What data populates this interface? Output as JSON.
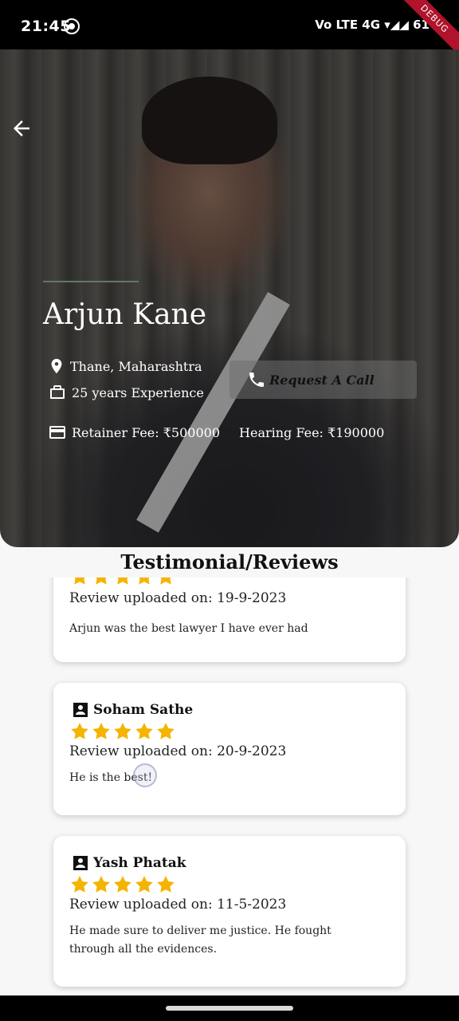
{
  "status_bar": {
    "time": "21:45",
    "right_icons": "Vo LTE 4G ▾◢◢ 61%",
    "debug_label": "DEBUG"
  },
  "profile": {
    "name": "Arjun Kane",
    "location": "Thane, Maharashtra",
    "experience": "25 years Experience",
    "retainer_fee": "Retainer Fee: ₹500000",
    "hearing_fee": "Hearing Fee: ₹190000",
    "call_button_label": "Request A Call"
  },
  "reviews_section": {
    "title": "Testimonial/Reviews",
    "reviews": [
      {
        "reviewer": "",
        "stars": 5,
        "date": "Review uploaded on: 19-9-2023",
        "text": "Arjun was the best lawyer I have ever had"
      },
      {
        "reviewer": "Soham Sathe",
        "stars": 5,
        "date": "Review uploaded on: 20-9-2023",
        "text": "He is the best!"
      },
      {
        "reviewer": "Yash Phatak",
        "stars": 5,
        "date": "Review uploaded on: 11-5-2023",
        "text": "He made sure to deliver me justice. He fought through all the evidences."
      }
    ]
  },
  "colors": {
    "star": "#f4b400",
    "ribbon": "#b0132b",
    "background": "#f7f7f7"
  },
  "icons": [
    "back-arrow-icon",
    "location-pin-icon",
    "briefcase-icon",
    "card-icon",
    "phone-icon",
    "person-icon",
    "star-icon"
  ]
}
